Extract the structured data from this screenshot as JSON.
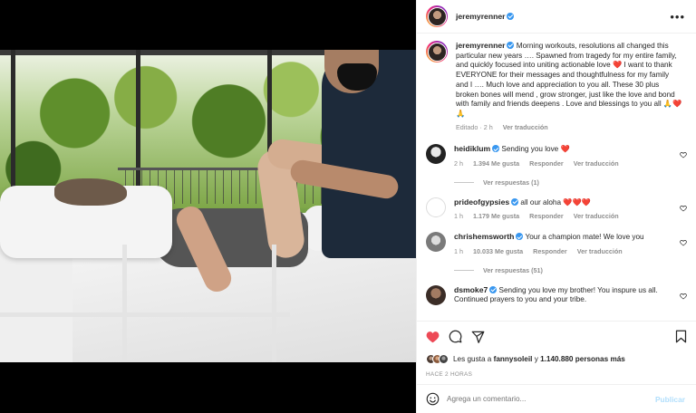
{
  "post": {
    "username": "jeremyrenner",
    "more_label": "•••"
  },
  "caption": {
    "username": "jeremyrenner",
    "text": "Morning workouts, resolutions all changed this particular new years …. Spawned from tragedy for my entire family, and quickly focused into uniting actionable love ❤️ I want to thank EVERYONE for their messages and thoughtfulness for my family and I …. Much love and appreciation to you all. These 30 plus broken bones will mend , grow stronger, just like the love and bond with family and friends deepens . Love and blessings to you all 🙏❤️🙏",
    "edited": "Editado · 2 h",
    "see_translation": "Ver traducción"
  },
  "comments": [
    {
      "username": "heidiklum",
      "verified": true,
      "text": "Sending you love ❤️",
      "time": "2 h",
      "likes": "1.394 Me gusta",
      "reply": "Responder",
      "translate": "Ver traducción",
      "replies_label": "Ver respuestas (1)"
    },
    {
      "username": "prideofgypsies",
      "verified": true,
      "text": "all our aloha ❤️❤️❤️",
      "time": "1 h",
      "likes": "1.179 Me gusta",
      "reply": "Responder",
      "translate": "Ver traducción"
    },
    {
      "username": "chrishemsworth",
      "verified": true,
      "text": "Your a champion mate! We love you",
      "time": "1 h",
      "likes": "10.033 Me gusta",
      "reply": "Responder",
      "translate": "Ver traducción",
      "replies_label": "Ver respuestas (51)"
    },
    {
      "username": "dsmoke7",
      "verified": true,
      "text": "Sending you love my brother! You inspure us all. Continued prayers to you and your tribe."
    }
  ],
  "likes": {
    "prefix": "Les gusta a",
    "user": "fannysoleil",
    "connector": "y",
    "count": "1.140.880 personas más"
  },
  "timestamp": "HACE 2 HORAS",
  "add_comment": {
    "placeholder": "Agrega un comentario...",
    "post_label": "Publicar"
  },
  "colors": {
    "like_active": "#ed4956",
    "verified": "#3897f0",
    "post_disabled": "#b2dffc"
  }
}
